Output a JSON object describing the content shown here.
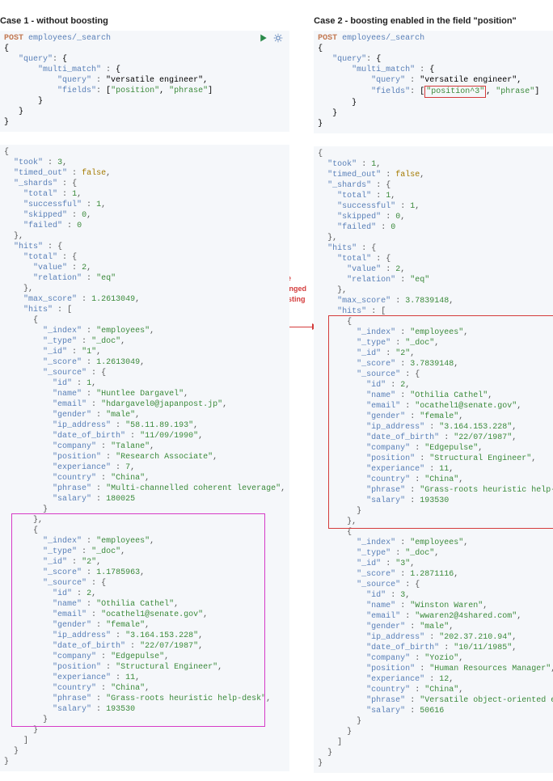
{
  "case1": {
    "title": "Case 1 - without boosting",
    "request": {
      "verb": "POST",
      "path": "employees/_search",
      "body": "{\n   \"query\": {\n       \"multi_match\" : {\n           \"query\" : \"versatile engineer\",\n           \"fields\": [\"position\", \"phrase\"]\n       }\n   }\n}"
    },
    "response_meta": {
      "took": 3,
      "timed_out": false,
      "shards": {
        "total": 1,
        "successful": 1,
        "skipped": 0,
        "failed": 0
      },
      "hits_total_value": 2,
      "hits_total_relation": "eq",
      "max_score": 1.2613049
    },
    "hits": [
      {
        "_index": "employees",
        "_type": "_doc",
        "_id": "1",
        "_score": 1.2613049,
        "_source": {
          "id": 1,
          "name": "Huntlee Dargavel",
          "email": "hdargavel0@japanpost.jp",
          "gender": "male",
          "ip_address": "58.11.89.193",
          "date_of_birth": "11/09/1990",
          "company": "Talane",
          "position": "Research Associate",
          "experiance": 7,
          "country": "China",
          "phrase": "Multi-channelled coherent leverage",
          "salary": 180025
        }
      },
      {
        "_index": "employees",
        "_type": "_doc",
        "_id": "2",
        "_score": 1.1785963,
        "_source": {
          "id": 2,
          "name": "Othilia Cathel",
          "email": "ocathel1@senate.gov",
          "gender": "female",
          "ip_address": "3.164.153.228",
          "date_of_birth": "22/07/1987",
          "company": "Edgepulse",
          "position": "Structural Engineer",
          "experiance": 11,
          "country": "China",
          "phrase": "Grass-roots heuristic help-desk",
          "salary": 193530
        }
      }
    ]
  },
  "case2": {
    "title": "Case 2 - boosting enabled in the field \"position\"",
    "request": {
      "verb": "POST",
      "path": "employees/_search",
      "boosted_field": "\"position^3\"",
      "body_prefix": "{\n   \"query\": {\n       \"multi_match\" : {\n           \"query\" : \"versatile engineer\",\n           \"fields\": [",
      "body_suffix": ", \"phrase\"]\n       }\n   }\n}"
    },
    "response_meta": {
      "took": 1,
      "timed_out": false,
      "shards": {
        "total": 1,
        "successful": 1,
        "skipped": 0,
        "failed": 0
      },
      "hits_total_value": 2,
      "hits_total_relation": "eq",
      "max_score": 3.7839148
    },
    "hits": [
      {
        "_index": "employees",
        "_type": "_doc",
        "_id": "2",
        "_score": 3.7839148,
        "_source": {
          "id": 2,
          "name": "Othilia Cathel",
          "email": "ocathel1@senate.gov",
          "gender": "female",
          "ip_address": "3.164.153.228",
          "date_of_birth": "22/07/1987",
          "company": "Edgepulse",
          "position": "Structural Engineer",
          "experiance": 11,
          "country": "China",
          "phrase": "Grass-roots heuristic help-desk",
          "salary": 193530
        }
      },
      {
        "_index": "employees",
        "_type": "_doc",
        "_id": "3",
        "_score": 1.2871116,
        "_source": {
          "id": 3,
          "name": "Winston Waren",
          "email": "wwaren2@4shared.com",
          "gender": "male",
          "ip_address": "202.37.210.94",
          "date_of_birth": "10/11/1985",
          "company": "Yozio",
          "position": "Human Resources Manager",
          "experiance": 12,
          "country": "China",
          "phrase": "Versatile object-oriented emulation",
          "salary": 50616
        }
      }
    ]
  },
  "annotation": {
    "text": "order of the results changed due to boosting"
  }
}
